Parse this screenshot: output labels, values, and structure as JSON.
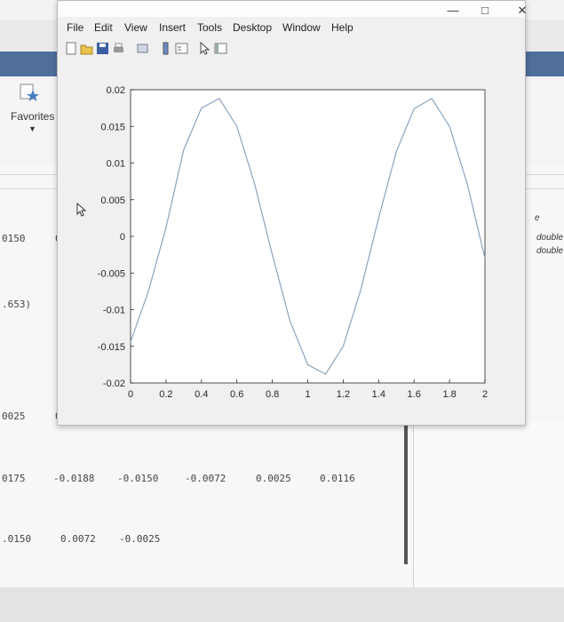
{
  "background": {
    "favorites_label": "Favorites",
    "row1": {
      "col0": "0150",
      "col1": "0"
    },
    "row2": {
      "col0": ".653)"
    },
    "row3": {
      "col0": "0025",
      "col1": "0."
    },
    "row4": [
      "0175",
      "-0.0188",
      "-0.0150",
      "-0.0072",
      "0.0025",
      "0.0116"
    ],
    "row5": [
      ".0150",
      "0.0072",
      "-0.0025"
    ],
    "right_panel": [
      "e",
      "double",
      "double"
    ]
  },
  "figure": {
    "menu": [
      "File",
      "Edit",
      "View",
      "Insert",
      "Tools",
      "Desktop",
      "Window",
      "Help"
    ],
    "window_buttons": {
      "minimize": "—",
      "maximize": "□",
      "close": "✕"
    }
  },
  "chart_data": {
    "type": "line",
    "title": "",
    "xlabel": "",
    "ylabel": "",
    "xlim": [
      0,
      2
    ],
    "ylim": [
      -0.02,
      0.02
    ],
    "x_ticks": [
      "0",
      "0.2",
      "0.4",
      "0.6",
      "0.8",
      "1",
      "1.2",
      "1.4",
      "1.6",
      "1.8",
      "2"
    ],
    "y_ticks": [
      "0.02",
      "0.015",
      "0.01",
      "0.005",
      "0",
      "-0.005",
      "-0.01",
      "-0.015",
      "-0.02"
    ],
    "grid": false,
    "series": [
      {
        "color": "#8aa4c0",
        "x": [
          0,
          0.1,
          0.2,
          0.3,
          0.4,
          0.5,
          0.6,
          0.7,
          0.8,
          0.9,
          1.0,
          1.1,
          1.2,
          1.3,
          1.4,
          1.5,
          1.6,
          1.7,
          1.8,
          1.9,
          2.0
        ],
        "y": [
          -0.0144,
          -0.0075,
          0.0012,
          0.0118,
          0.0175,
          0.0188,
          0.015,
          0.0072,
          -0.0025,
          -0.0116,
          -0.0175,
          -0.0188,
          -0.015,
          -0.0072,
          0.0025,
          0.0116,
          0.0174,
          0.0188,
          0.015,
          0.0072,
          -0.003
        ]
      }
    ]
  }
}
